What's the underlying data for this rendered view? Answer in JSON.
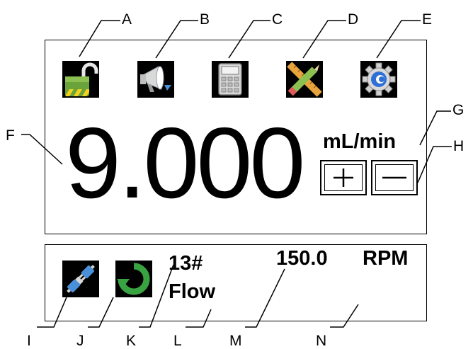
{
  "callouts": {
    "A": "A",
    "B": "B",
    "C": "C",
    "D": "D",
    "E": "E",
    "F": "F",
    "G": "G",
    "H": "H",
    "I": "I",
    "J": "J",
    "K": "K",
    "L": "L",
    "M": "M",
    "N": "N"
  },
  "toolbar": {
    "icons": [
      "unlock-icon",
      "megaphone-icon",
      "calculator-icon",
      "pencil-ruler-icon",
      "gear-icon"
    ]
  },
  "display": {
    "value": "9.000",
    "unit": "mL/min",
    "increase_symbol": "+",
    "decrease_symbol": "−"
  },
  "status": {
    "tube": "13#",
    "mode": "Flow",
    "speed": "150.0",
    "speed_unit": "RPM",
    "icons": [
      "plug-connected-icon",
      "rotate-icon"
    ]
  },
  "colors": {
    "icon_background": "#000000",
    "lock_green": "#6aa33a",
    "plug_blue": "#4a90d9",
    "rotate_green": "#3aa341",
    "gear_blue": "#2f6fd6"
  }
}
